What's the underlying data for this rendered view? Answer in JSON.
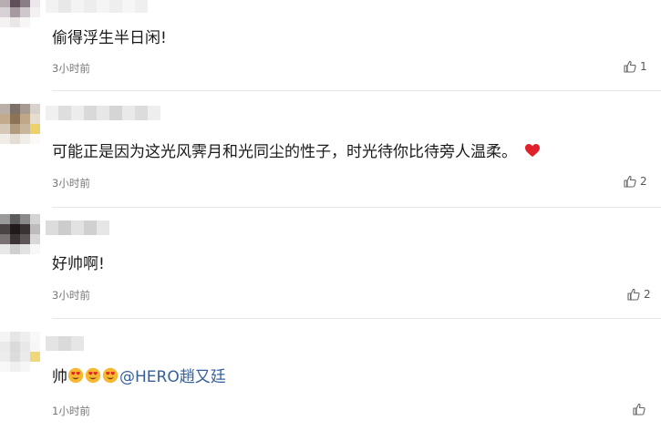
{
  "comments": [
    {
      "text": "偷得浮生半日闲!",
      "time": "3小时前",
      "likes": "1"
    },
    {
      "text": "可能正是因为这光风霁月和光同尘的性子，时光待你比待旁人温柔。",
      "emoji": "heart",
      "time": "3小时前",
      "likes": "2"
    },
    {
      "text": "好帅啊!",
      "time": "3小时前",
      "likes": "2"
    },
    {
      "text_prefix": "帅",
      "emoji_count": 3,
      "emoji": "heart-eyes",
      "mention": "@HERO趙又廷",
      "time": "1小时前",
      "likes": ""
    }
  ],
  "colors": {
    "mention": "#36609c",
    "time": "#777777",
    "heart": "#e0202a",
    "divider": "#e6e6e6"
  }
}
